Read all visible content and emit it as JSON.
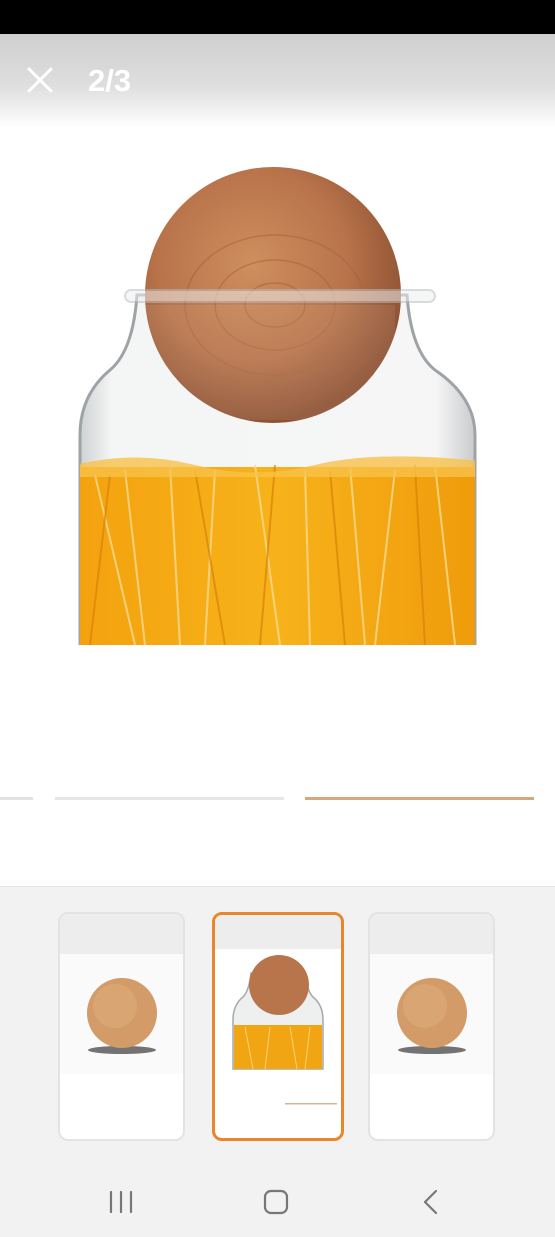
{
  "viewer": {
    "counter": "2/3",
    "current_index": 2,
    "total": 3,
    "accent_color": "#e9852a"
  },
  "icons": {
    "close": "close-icon",
    "nav_recents": "recent-apps-icon",
    "nav_home": "home-icon",
    "nav_back": "back-icon"
  },
  "thumbnails": [
    {
      "subject": "wooden-ball-lid",
      "selected": false
    },
    {
      "subject": "glass-jar-with-spaghetti",
      "selected": true
    },
    {
      "subject": "wooden-ball-lid",
      "selected": false
    }
  ]
}
